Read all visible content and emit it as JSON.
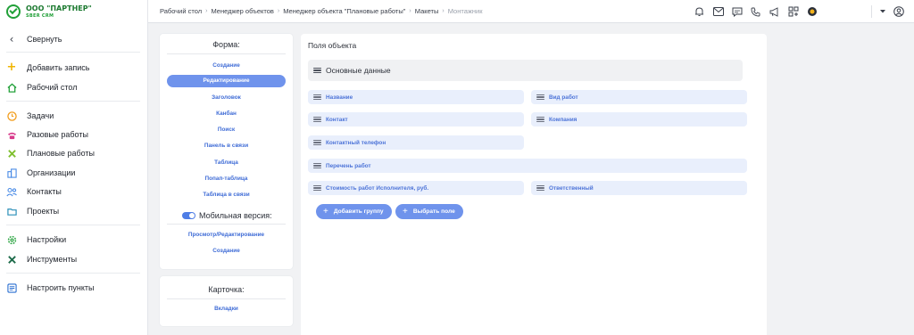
{
  "brand": {
    "name": "ООО \"ПАРТНЕР\"",
    "sub": "SBER CRM"
  },
  "sidebar": {
    "items": [
      {
        "label": "Свернуть",
        "icon": "chevron-left-icon"
      },
      {
        "label": "Добавить запись",
        "icon": "plus-icon"
      },
      {
        "label": "Рабочий стол",
        "icon": "home-icon"
      },
      {
        "label": "Задачи",
        "icon": "clock-icon"
      },
      {
        "label": "Разовые работы",
        "icon": "phone-icon"
      },
      {
        "label": "Плановые работы",
        "icon": "tools-cross-icon"
      },
      {
        "label": "Организации",
        "icon": "building-icon"
      },
      {
        "label": "Контакты",
        "icon": "contacts-icon"
      },
      {
        "label": "Проекты",
        "icon": "folder-icon"
      },
      {
        "label": "Настройки",
        "icon": "gear-icon"
      },
      {
        "label": "Инструменты",
        "icon": "wrench-icon"
      },
      {
        "label": "Настроить пункты",
        "icon": "list-settings-icon"
      }
    ]
  },
  "breadcrumb": {
    "items": [
      "Рабочий стол",
      "Менеджер объектов",
      "Менеджер объекта \"Плановые работы\"",
      "Макеты",
      "Монтажник"
    ]
  },
  "topbar": {
    "icons": [
      "bell-icon",
      "mail-icon",
      "chat-icon",
      "phone-icon",
      "megaphone-icon",
      "modules-icon",
      "status-icon",
      "dropdown-caret-icon",
      "user-icon"
    ]
  },
  "form_panel": {
    "title": "Форма:",
    "links": [
      "Создание",
      "Редактирование",
      "Заголовок",
      "Канбан",
      "Поиск",
      "Панель в связи",
      "Таблица",
      "Попап-таблица",
      "Таблица в связи"
    ],
    "active_index": 1,
    "mobile_label": "Мобильная версия:",
    "mobile_enabled": true,
    "mobile_links": [
      "Просмотр/Редактирование",
      "Создание"
    ]
  },
  "card_panel": {
    "title": "Карточка:",
    "links": [
      "Вкладки"
    ]
  },
  "main": {
    "title": "Поля объекта",
    "group_label": "Основные данные",
    "fields": [
      "Название",
      "Вид работ",
      "Контакт",
      "Компания",
      "Контактный телефон",
      "Перечень работ",
      "Стоимость работ Исполнителя, руб.",
      "Ответственный"
    ],
    "buttons": {
      "add_group": "Добавить группу",
      "choose_field": "Выбрать поле"
    }
  },
  "colors": {
    "accent": "#6f93ec",
    "link": "#3e6bd6",
    "brand": "#21a038"
  }
}
